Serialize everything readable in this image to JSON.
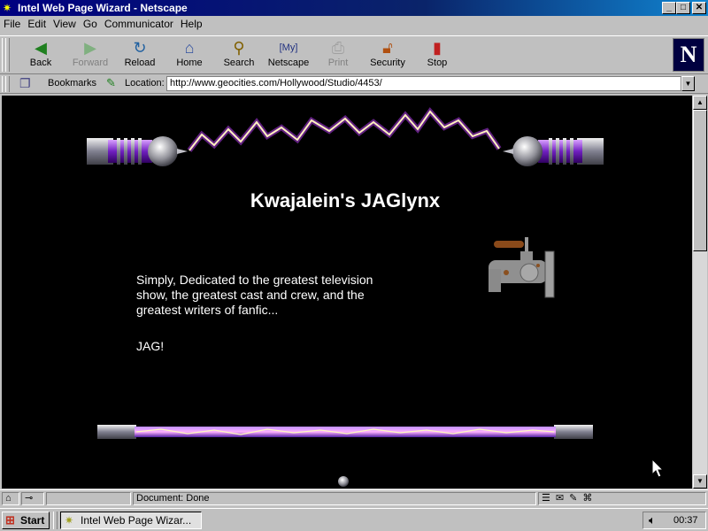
{
  "window": {
    "title": "Intel Web Page Wizard - Netscape",
    "minimize": "_",
    "maximize": "□",
    "close": "✕"
  },
  "menu": [
    "File",
    "Edit",
    "View",
    "Go",
    "Communicator",
    "Help"
  ],
  "toolbar": {
    "buttons": [
      {
        "label": "Back",
        "icon": "back-arrow-icon",
        "enabled": true
      },
      {
        "label": "Forward",
        "icon": "forward-arrow-icon",
        "enabled": false
      },
      {
        "label": "Reload",
        "icon": "reload-icon",
        "enabled": true
      },
      {
        "label": "Home",
        "icon": "home-icon",
        "enabled": true
      },
      {
        "label": "Search",
        "icon": "search-icon",
        "enabled": true
      },
      {
        "label": "Netscape",
        "icon": "netscape-my-icon",
        "enabled": true
      },
      {
        "label": "Print",
        "icon": "print-icon",
        "enabled": false
      },
      {
        "label": "Security",
        "icon": "lock-icon",
        "enabled": true
      },
      {
        "label": "Stop",
        "icon": "stop-icon",
        "enabled": true
      }
    ],
    "logo_letter": "N"
  },
  "location": {
    "bookmarks_label": "Bookmarks",
    "location_label": "Location:",
    "url": "http://www.geocities.com/Hollywood/Studio/4453/"
  },
  "page": {
    "title": "Kwajalein's JAGlynx",
    "intro": "Simply, Dedicated to the greatest television show, the greatest cast and crew, and the greatest writers of fanfic...",
    "tag": "JAG!",
    "background": "#000000",
    "text_color": "#ffffff",
    "arc_color": "#ff9cff"
  },
  "status": {
    "text": "Document: Done"
  },
  "taskbar": {
    "start_label": "Start",
    "task_label": "Intel Web Page Wizar...",
    "clock": "00:37"
  }
}
